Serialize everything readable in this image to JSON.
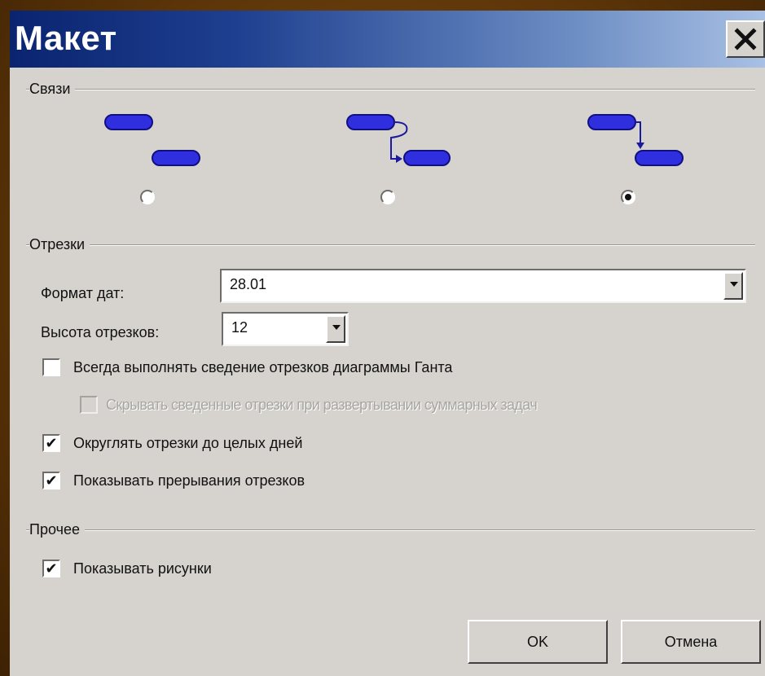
{
  "dialog": {
    "title": "Макет",
    "close_glyph": "✕"
  },
  "links": {
    "label": "Связи",
    "options": [
      {
        "name": "no-links",
        "selected": false
      },
      {
        "name": "curved-links",
        "selected": false
      },
      {
        "name": "straight-links",
        "selected": true
      }
    ],
    "bar_color": "#2f2fe0"
  },
  "bars": {
    "label": "Отрезки",
    "date_format_label": "Формат дат:",
    "date_format_value": "28.01",
    "bar_height_label": "Высота отрезков:",
    "bar_height_value": "12",
    "always_rollup_label": "Всегда выполнять сведение отрезков диаграммы Ганта",
    "always_rollup_checked": false,
    "hide_rollup_label": "Скрывать сведенные отрезки при развертывании суммарных задач",
    "hide_rollup_checked": false,
    "round_bars_label": "Округлять отрезки до целых дней",
    "round_bars_checked": true,
    "show_splits_label": "Показывать прерывания отрезков",
    "show_splits_checked": true
  },
  "other": {
    "label": "Прочее",
    "show_drawings_label": "Показывать рисунки",
    "show_drawings_checked": true
  },
  "buttons": {
    "ok": "OK",
    "cancel": "Отмена"
  },
  "check_glyph": "✔"
}
